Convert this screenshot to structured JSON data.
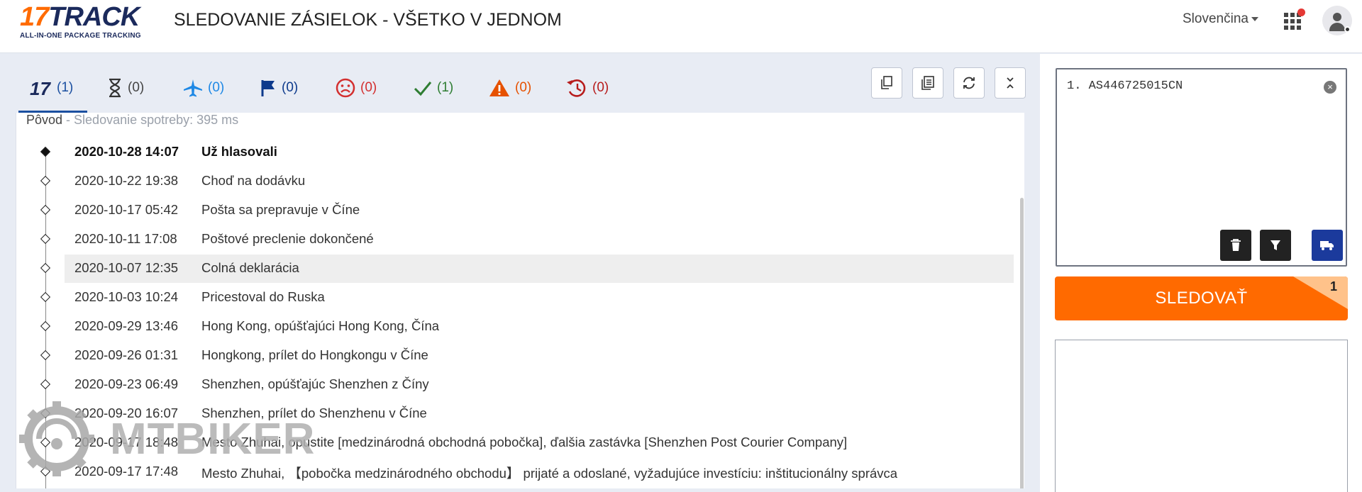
{
  "header": {
    "logo_main": "17TRACK",
    "logo_sub": "ALL-IN-ONE PACKAGE TRACKING",
    "title": "SLEDOVANIE ZÁSIELOK - VŠETKO V JEDNOM",
    "language": "Slovenčina"
  },
  "tabs": [
    {
      "icon": "17track-logo-icon",
      "count": "(1)",
      "color": "#1b4fa0"
    },
    {
      "icon": "hourglass-icon",
      "count": "(0)",
      "color": "#444444"
    },
    {
      "icon": "airplane-icon",
      "count": "(0)",
      "color": "#1e88e5"
    },
    {
      "icon": "flag-icon",
      "count": "(0)",
      "color": "#0d3a8c"
    },
    {
      "icon": "sad-face-icon",
      "count": "(0)",
      "color": "#d32f2f"
    },
    {
      "icon": "check-icon",
      "count": "(1)",
      "color": "#2e7d32"
    },
    {
      "icon": "warning-icon",
      "count": "(0)",
      "color": "#e65100"
    },
    {
      "icon": "history-icon",
      "count": "(0)",
      "color": "#b71c1c"
    }
  ],
  "events": {
    "header_label": "Pôvod",
    "header_meta": " - Sledovanie spotreby: 395 ms",
    "items": [
      {
        "date": "2020-10-28 14:07",
        "desc": "Už hlasovali"
      },
      {
        "date": "2020-10-22 19:38",
        "desc": "Choď na dodávku"
      },
      {
        "date": "2020-10-17 05:42",
        "desc": "Pošta sa prepravuje v Číne"
      },
      {
        "date": "2020-10-11 17:08",
        "desc": "Poštové preclenie dokončené"
      },
      {
        "date": "2020-10-07 12:35",
        "desc": "Colná deklarácia"
      },
      {
        "date": "2020-10-03 10:24",
        "desc": "Pricestoval do Ruska"
      },
      {
        "date": "2020-09-29 13:46",
        "desc": "Hong Kong, opúšťajúci Hong Kong, Čína"
      },
      {
        "date": "2020-09-26 01:31",
        "desc": "Hongkong, prílet do Hongkongu v Číne"
      },
      {
        "date": "2020-09-23 06:49",
        "desc": "Shenzhen, opúšťajúc Shenzhen z Číny"
      },
      {
        "date": "2020-09-20 16:07",
        "desc": "Shenzhen, prílet do Shenzhenu v Číne"
      },
      {
        "date": "2020-09-17 18:48",
        "desc": "Mesto Zhuhai, opustite [medzinárodná obchodná pobočka], ďalšia zastávka [Shenzhen Post Courier Company]"
      },
      {
        "date": "2020-09-17 17:48",
        "desc": "Mesto Zhuhai, 【pobočka medzinárodného obchodu】 prijaté a odoslané, vyžadujúce investíciu: inštitucionálny správca"
      }
    ]
  },
  "tracking": {
    "numbers_text": "1. AS446725015CN",
    "track_button": "SLEDOVAŤ",
    "badge_count": "1"
  },
  "watermark": {
    "text": "MTBIKER"
  },
  "colors": {
    "accent_orange": "#ff6a00",
    "brand_navy": "#1b2a5c",
    "tab_active": "#1b4fa0"
  }
}
